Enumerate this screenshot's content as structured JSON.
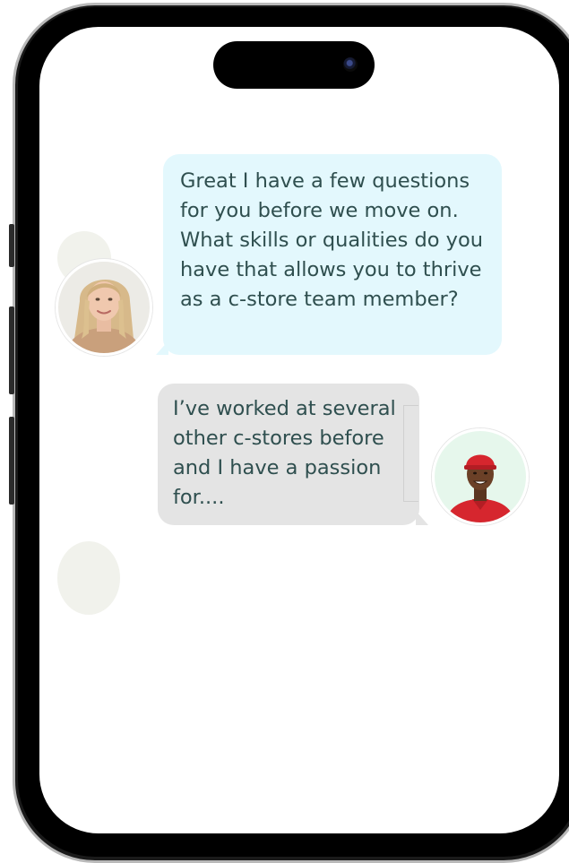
{
  "chat": {
    "messages": [
      {
        "sender": "recruiter",
        "text": "Great I have a few questions for you before we move on. What skills or qualities do you have that allows you to thrive as a c-store team member?"
      },
      {
        "sender": "applicant",
        "text": "I’ve worked at several other c-stores before and I have a passion for...."
      }
    ]
  },
  "colors": {
    "recruiter_bubble": "#e3f8fd",
    "applicant_bubble": "#e4e4e4",
    "message_text": "#2f4f4f",
    "applicant_avatar_bg": "#e6f7ec"
  },
  "icons": {
    "recruiter_avatar": "woman-portrait",
    "applicant_avatar": "man-red-cap-portrait",
    "camera": "front-camera-icon"
  }
}
